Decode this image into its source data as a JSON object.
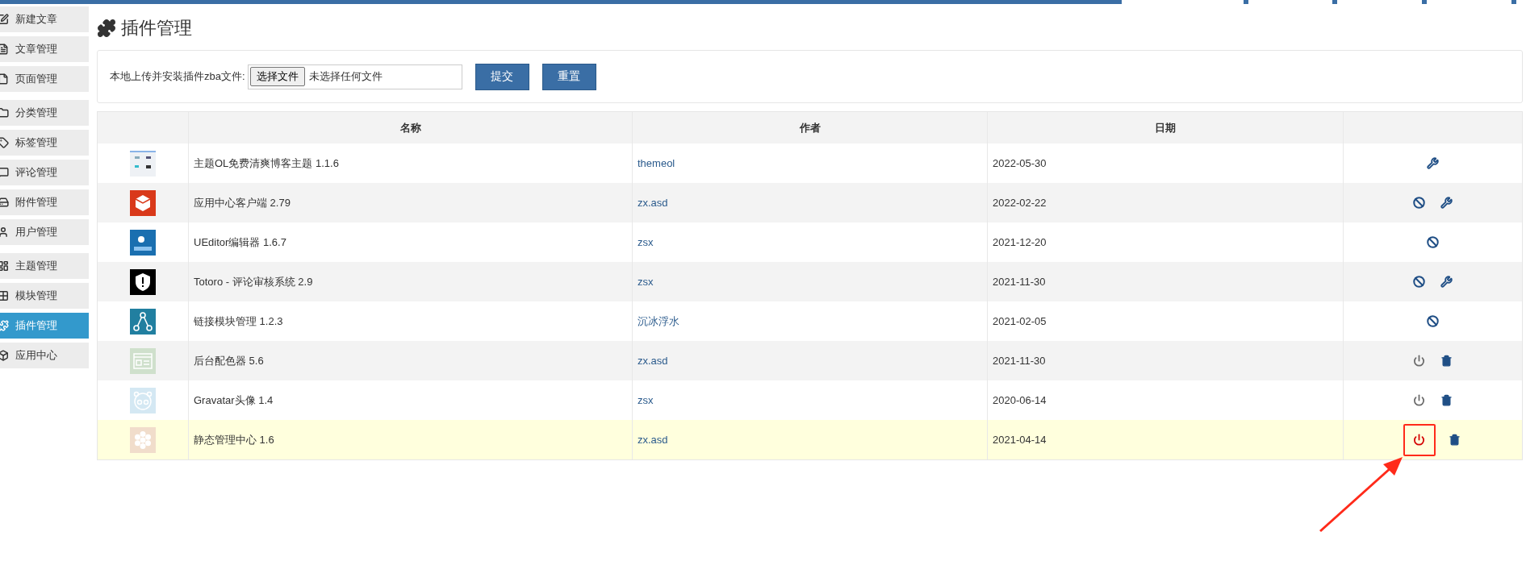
{
  "sidebar": {
    "groups": [
      {
        "items": [
          {
            "label": "新建文章",
            "selected": false
          },
          {
            "label": "文章管理",
            "selected": false
          },
          {
            "label": "页面管理",
            "selected": false
          }
        ]
      },
      {
        "items": [
          {
            "label": "分类管理",
            "selected": false
          },
          {
            "label": "标签管理",
            "selected": false
          },
          {
            "label": "评论管理",
            "selected": false
          },
          {
            "label": "附件管理",
            "selected": false
          },
          {
            "label": "用户管理",
            "selected": false
          }
        ]
      },
      {
        "items": [
          {
            "label": "主题管理",
            "selected": false
          },
          {
            "label": "模块管理",
            "selected": false
          },
          {
            "label": "插件管理",
            "selected": true
          },
          {
            "label": "应用中心",
            "selected": false
          }
        ]
      }
    ]
  },
  "page_title": "插件管理",
  "upload": {
    "label": "本地上传并安装插件zba文件:",
    "choose_button": "选择文件",
    "file_status": "未选择任何文件",
    "buttons": [
      "提交",
      "重置"
    ]
  },
  "table": {
    "columns": [
      "名称",
      "作者",
      "日期"
    ],
    "rows": [
      {
        "name": "主题OL免费清爽博客主题 1.1.6",
        "author": "themeol",
        "date": "2022-05-30",
        "highlighted": false,
        "actions": [
          {
            "kind": "settings",
            "highlighted": false
          }
        ]
      },
      {
        "name": "应用中心客户端 2.79",
        "author": "zx.asd",
        "date": "2022-02-22",
        "highlighted": false,
        "actions": [
          {
            "kind": "disable",
            "highlighted": false
          },
          {
            "kind": "settings",
            "highlighted": false
          }
        ]
      },
      {
        "name": "UEditor编辑器 1.6.7",
        "author": "zsx",
        "date": "2021-12-20",
        "highlighted": false,
        "actions": [
          {
            "kind": "disable",
            "highlighted": false
          }
        ]
      },
      {
        "name": "Totoro - 评论审核系统 2.9",
        "author": "zsx",
        "date": "2021-11-30",
        "highlighted": false,
        "actions": [
          {
            "kind": "disable",
            "highlighted": false
          },
          {
            "kind": "settings",
            "highlighted": false
          }
        ]
      },
      {
        "name": "链接模块管理 1.2.3",
        "author": "沉冰浮水",
        "date": "2021-02-05",
        "highlighted": false,
        "actions": [
          {
            "kind": "disable",
            "highlighted": false
          }
        ]
      },
      {
        "name": "后台配色器 5.6",
        "author": "zx.asd",
        "date": "2021-11-30",
        "highlighted": false,
        "actions": [
          {
            "kind": "enable",
            "highlighted": false
          },
          {
            "kind": "delete",
            "highlighted": false
          }
        ]
      },
      {
        "name": "Gravatar头像 1.4",
        "author": "zsx",
        "date": "2020-06-14",
        "highlighted": false,
        "actions": [
          {
            "kind": "enable",
            "highlighted": false
          },
          {
            "kind": "delete",
            "highlighted": false
          }
        ]
      },
      {
        "name": "静态管理中心 1.6",
        "author": "zx.asd",
        "date": "2021-04-14",
        "highlighted": true,
        "actions": [
          {
            "kind": "enable",
            "highlighted": true
          },
          {
            "kind": "delete",
            "highlighted": false
          }
        ]
      }
    ]
  }
}
